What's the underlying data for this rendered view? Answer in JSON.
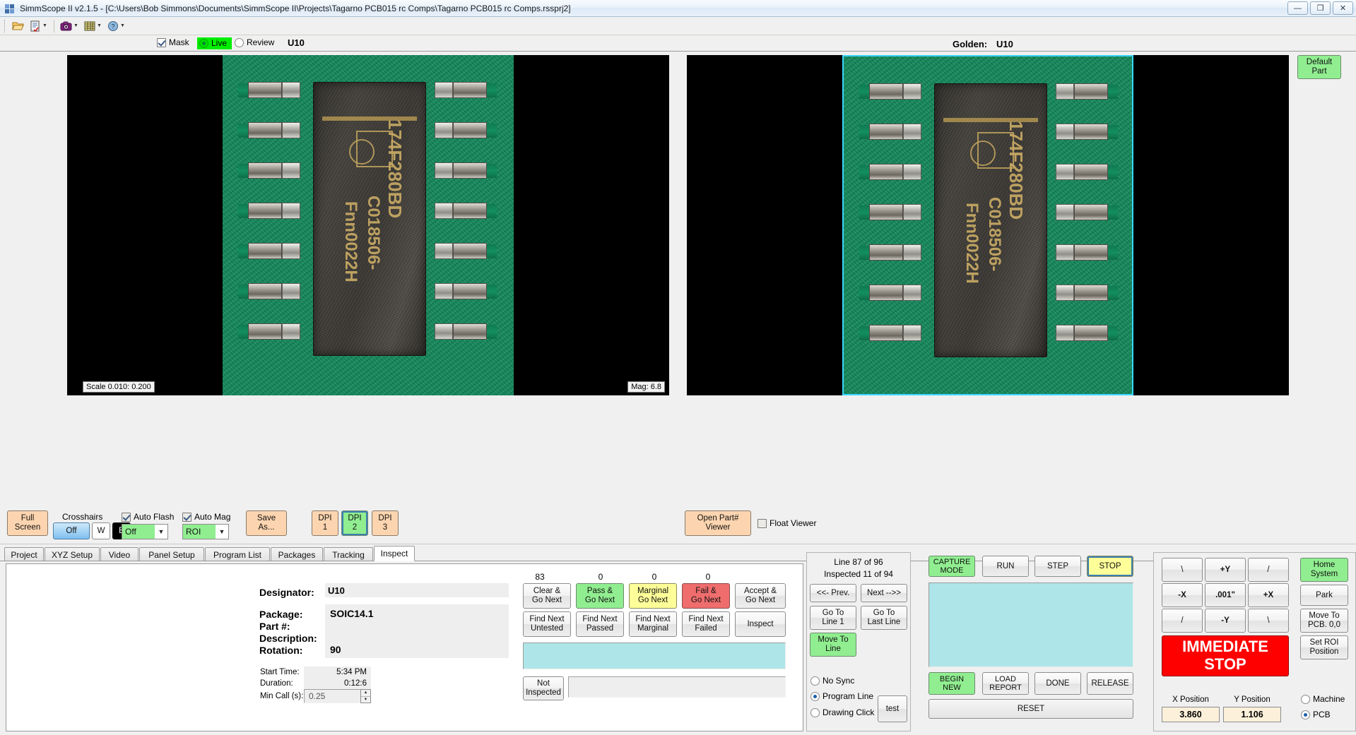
{
  "window": {
    "title": "SimmScope II  v2.1.5 - [C:\\Users\\Bob Simmons\\Documents\\SimmScope II\\Projects\\Tagarno PCB015 rc Comps\\Tagarno PCB015 rc Comps.rssprj2]",
    "minimize": "—",
    "restore": "❐",
    "close": "✕"
  },
  "toolbar": {
    "open_icon": "folder-open-icon",
    "report_icon": "report-icon",
    "camera_icon": "camera-icon",
    "grid_icon": "grid-icon",
    "help_icon": "help-icon",
    "dropdown_glyph": "▼"
  },
  "viewbar": {
    "mask_label": "Mask",
    "mask_checked": true,
    "live_label": "Live",
    "live_selected": true,
    "review_label": "Review",
    "review_selected": false,
    "designator": "U10",
    "golden_label": "Golden:",
    "golden_value": "U10",
    "default_part_label": "Default\nPart"
  },
  "live_view": {
    "scale_label": "Scale 0.010:  0.200",
    "mag_label": "Mag: 6.8",
    "ic_marking_line1": "174F280BD",
    "ic_marking_line2": "C018506-",
    "ic_marking_line3": "Fnn0022H"
  },
  "controls": {
    "full_screen": "Full\nScreen",
    "crosshairs_label": "Crosshairs",
    "crosshairs_off": "Off",
    "crosshairs_w": "W",
    "crosshairs_b": "B",
    "auto_flash_label": "Auto Flash",
    "auto_flash_checked": true,
    "auto_flash_value": "Off",
    "auto_mag_label": "Auto Mag",
    "auto_mag_checked": true,
    "auto_mag_value": "ROI",
    "save_as": "Save\nAs...",
    "dpi1": "DPI\n1",
    "dpi2": "DPI\n2",
    "dpi3": "DPI\n3",
    "dpi_selected": 2,
    "open_part_viewer": "Open Part#\nViewer",
    "float_viewer_label": "Float Viewer",
    "float_viewer_checked": false
  },
  "tabs": [
    {
      "label": "Project",
      "active": false
    },
    {
      "label": "XYZ Setup",
      "active": false
    },
    {
      "label": "Video",
      "active": false
    },
    {
      "label": "Panel Setup",
      "active": false
    },
    {
      "label": "Program List",
      "active": false
    },
    {
      "label": "Packages",
      "active": false
    },
    {
      "label": "Tracking",
      "active": false
    },
    {
      "label": "Inspect",
      "active": true
    }
  ],
  "inspect": {
    "designator_label": "Designator:",
    "designator_value": "U10",
    "package_label": "Package:",
    "package_value": "SOIC14.1",
    "partnum_label": "Part #:",
    "partnum_value": "",
    "description_label": "Description:",
    "description_value": "",
    "rotation_label": "Rotation:",
    "rotation_value": "90",
    "start_time_label": "Start Time:",
    "start_time_value": "5:34 PM",
    "duration_label": "Duration:",
    "duration_value": "0:12:6",
    "min_call_label": "Min Call (s):",
    "min_call_value": "0.25"
  },
  "verdict": {
    "counts": [
      "83",
      "0",
      "0",
      "0"
    ],
    "row1": [
      {
        "label": "Clear &\nGo Next",
        "style": "plain"
      },
      {
        "label": "Pass &\nGo Next",
        "style": "green"
      },
      {
        "label": "Marginal\nGo Next",
        "style": "yellow"
      },
      {
        "label": "Fail &\nGo Next",
        "style": "red"
      },
      {
        "label": "Accept &\nGo Next",
        "style": "plain"
      }
    ],
    "row2": [
      {
        "label": "Find Next\nUntested"
      },
      {
        "label": "Find Next\nPassed"
      },
      {
        "label": "Find Next\nMarginal"
      },
      {
        "label": "Find Next\nFailed"
      },
      {
        "label": "Inspect"
      }
    ],
    "status_text": "",
    "not_inspected_label": "Not\nInspected",
    "not_inspected_value": ""
  },
  "navigation": {
    "line_status": "Line 87 of 96",
    "inspected_status": "Inspected 11 of 94",
    "prev": "<<-  Prev.",
    "next": "Next  -->>",
    "go_to_line_1": "Go To\nLine 1",
    "go_to_last_line": "Go To\nLast Line",
    "move_to_line": "Move To\nLine",
    "sync_options": [
      {
        "label": "No Sync",
        "selected": false
      },
      {
        "label": "Program Line",
        "selected": true
      },
      {
        "label": "Drawing Click",
        "selected": false
      }
    ],
    "test_button": "test"
  },
  "run": {
    "capture_mode": "CAPTURE\nMODE",
    "run": "RUN",
    "step": "STEP",
    "stop": "STOP",
    "log_text": "",
    "begin_new": "BEGIN\nNEW",
    "load_report": "LOAD\nREPORT",
    "done": "DONE",
    "release": "RELEASE",
    "reset": "RESET"
  },
  "jog": {
    "pad": [
      [
        "\\",
        "+Y",
        "/"
      ],
      [
        "-X",
        ".001\"",
        "+X"
      ],
      [
        "/",
        "-Y",
        "\\"
      ]
    ],
    "immediate_stop": "IMMEDIATE\nSTOP",
    "home_system": "Home\nSystem",
    "park": "Park",
    "move_to_pcb": "Move To\nPCB. 0,0",
    "set_roi_position": "Set ROI\nPosition",
    "x_position_label": "X Position",
    "x_position_value": "3.860",
    "y_position_label": "Y Position",
    "y_position_value": "1.106",
    "coord_modes": [
      {
        "label": "Machine",
        "selected": false
      },
      {
        "label": "PCB",
        "selected": true
      }
    ]
  },
  "colors": {
    "accent_green": "#90ee90",
    "accent_peach": "#fcd5b0",
    "accent_yellow": "#ffff99",
    "accent_red": "#ef6d6d",
    "stop_red": "#ff0000",
    "cyan_panel": "#aee5e8",
    "pcb_green": "#13875a"
  }
}
